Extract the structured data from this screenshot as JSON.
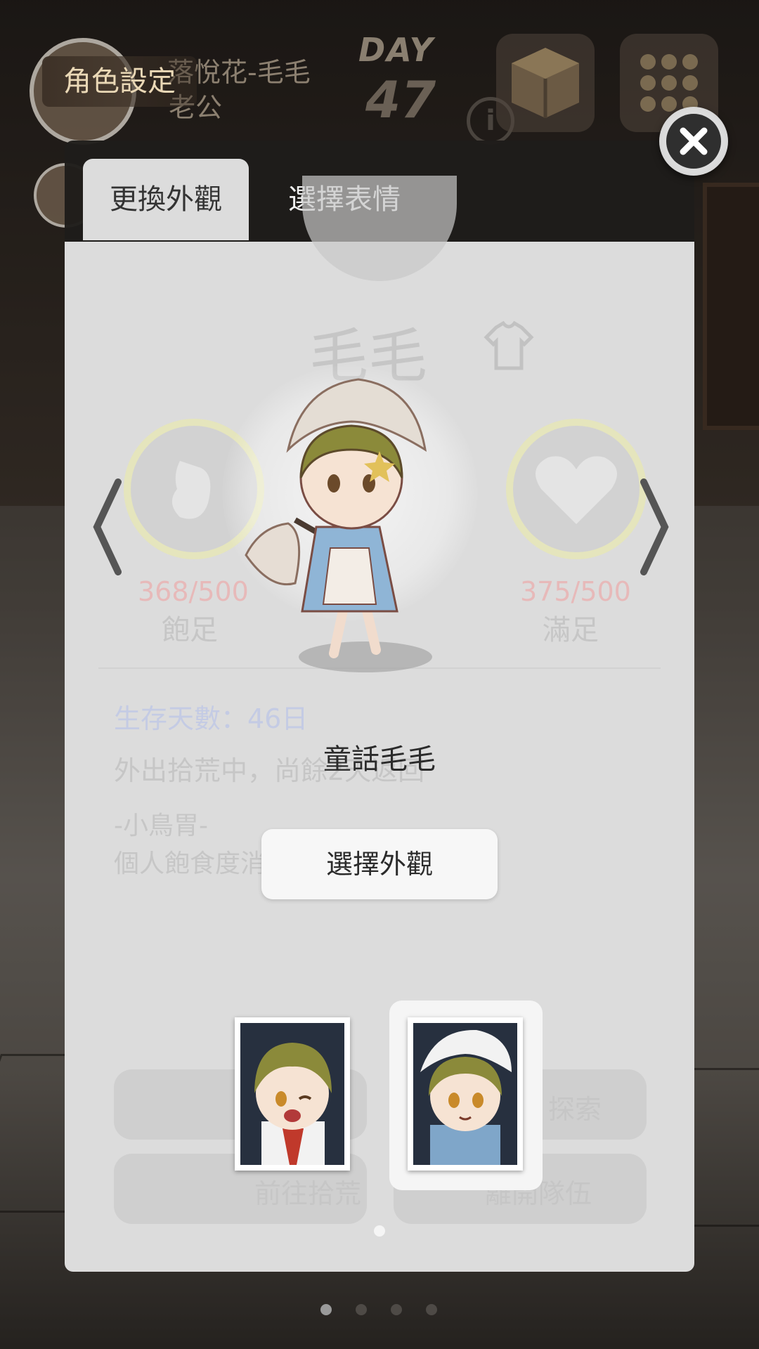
{
  "hud": {
    "day_label": "DAY",
    "day_number": "47",
    "partner_name": "落悅花-毛毛",
    "partner_role": "老公"
  },
  "char_settings_label": "角色設定",
  "tabs": [
    {
      "label": "更換外觀",
      "active": true
    },
    {
      "label": "選擇表情",
      "active": false
    }
  ],
  "background_info": {
    "name": "毛毛",
    "satiety_value": "368/500",
    "satiety_label": "飽足",
    "satisfaction_value": "375/500",
    "satisfaction_label": "滿足",
    "days_survived": "生存天數：46日",
    "status": "外出拾荒中，尚餘2天返回",
    "trait_title": "-小鳥胃-",
    "trait_desc": "個人飽食度消耗",
    "action_explore": "探索",
    "action_scavenge": "前往拾荒",
    "action_leave": "離開隊伍"
  },
  "outfit": {
    "name": "童話毛毛",
    "select_label": "選擇外觀"
  },
  "thumbnails": [
    {
      "name": "default-outfit",
      "selected": false
    },
    {
      "name": "fairy-tale-outfit",
      "selected": true
    }
  ],
  "page_dots": {
    "count": 4,
    "active_index": 0
  },
  "colors": {
    "modal_body": "#dcdcdc",
    "modal_header": "#1e1c1a",
    "tab_active": "#dcdcdc",
    "accent_gold": "#ead8b6"
  }
}
